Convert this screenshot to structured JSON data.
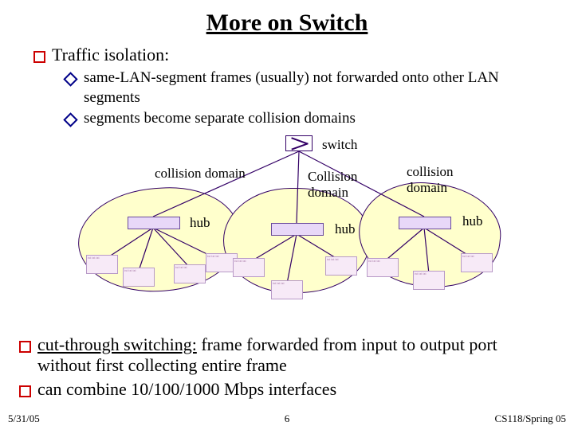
{
  "title": "More on Switch",
  "bullets": {
    "b1": "Traffic isolation:",
    "b1a": "same-LAN-segment frames (usually) not forwarded onto other LAN segments",
    "b1b": "segments become separate collision  domains",
    "b2_underline": "cut-through switching:",
    "b2_rest": " frame forwarded from input to output port without first collecting entire frame",
    "b3": "can combine 10/100/1000 Mbps interfaces"
  },
  "diagram": {
    "switch_label": "switch",
    "cd1": "collision domain",
    "cd2": "Collision domain",
    "cd3": "collision domain",
    "hub": "hub"
  },
  "footer": {
    "left": "5/31/05",
    "center": "6",
    "right": "CS118/Spring 05"
  }
}
